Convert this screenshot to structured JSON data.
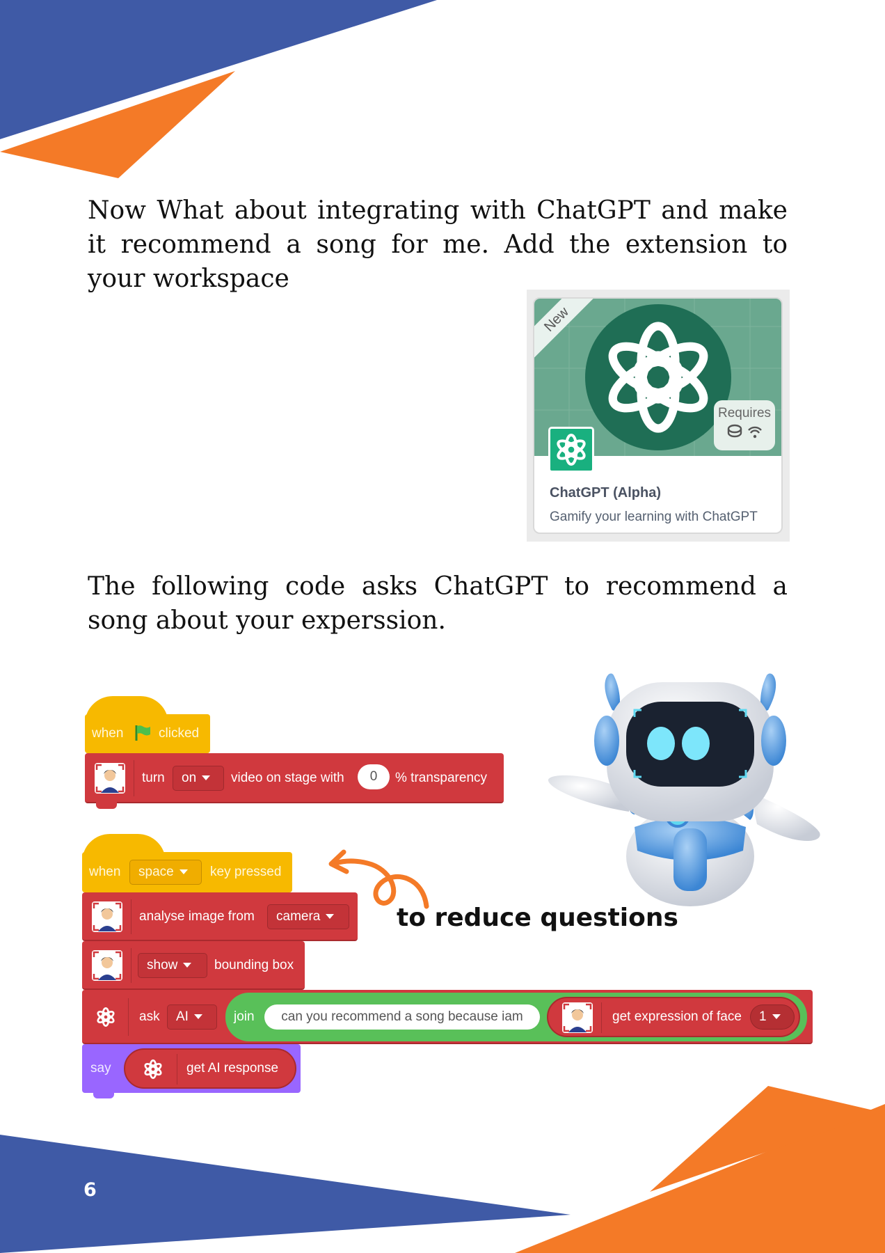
{
  "intro_text": "Now What about integrating with ChatGPT and make it recommend a song for me. Add the extension to your workspace",
  "extension_card": {
    "badge": "New",
    "requires_label": "Requires",
    "title": "ChatGPT (Alpha)",
    "subtitle": "Gamify your learning with ChatGPT"
  },
  "code_intro_text": "The following code asks ChatGPT to recommend a song about your experssion.",
  "script1": {
    "when": "when",
    "clicked": "clicked",
    "turn": "turn",
    "on": "on",
    "video_on_stage_with": "video on stage with",
    "transparency_value": "0",
    "transparency": "% transparency"
  },
  "script2": {
    "when": "when",
    "key": "space",
    "key_pressed": "key pressed",
    "analyse_image_from": "analyse image from",
    "camera": "camera",
    "show": "show",
    "bounding_box": "bounding box",
    "ask": "ask",
    "ai": "AI",
    "join": "join",
    "join_text": "can you recommend a song because iam",
    "get_expression_of_face": "get expression of face",
    "face_number": "1",
    "say": "say",
    "get_ai_response": "get AI response"
  },
  "callout": "to reduce questions",
  "page_number": "6",
  "colors": {
    "blue": "#3f5aa6",
    "orange": "#f47a27",
    "events": "#f7b900",
    "extension_red": "#d0393e",
    "operators_green": "#59c059",
    "looks_purple": "#9966ff",
    "chatgpt_green": "#19b07f"
  }
}
